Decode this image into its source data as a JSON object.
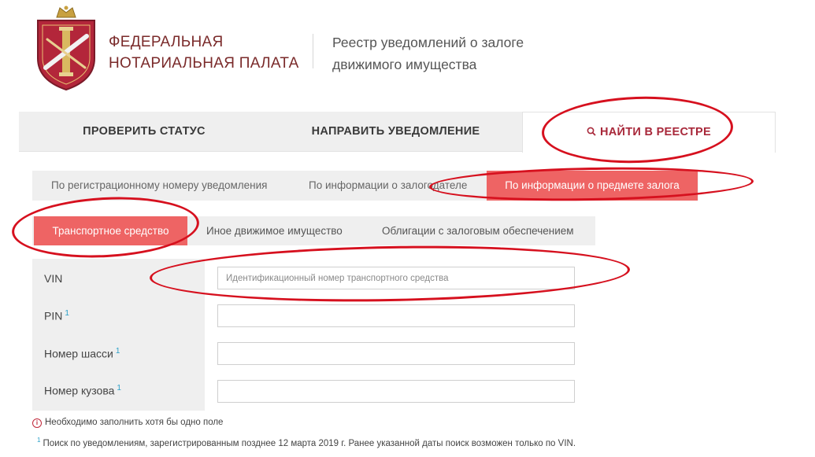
{
  "header": {
    "org_line1": "ФЕДЕРАЛЬНАЯ",
    "org_line2": "НОТАРИАЛЬНАЯ ПАЛАТА",
    "registry_line1": "Реестр уведомлений о залоге",
    "registry_line2": "движимого имущества"
  },
  "main_tabs": [
    {
      "label": "ПРОВЕРИТЬ СТАТУС"
    },
    {
      "label": "НАПРАВИТЬ УВЕДОМЛЕНИЕ"
    },
    {
      "label": "НАЙТИ В РЕЕСТРЕ",
      "icon": "search-icon",
      "active": true
    }
  ],
  "sub_tabs": [
    {
      "label": "По регистрационному номеру уведомления"
    },
    {
      "label": "По информации о залогодателе"
    },
    {
      "label": "По информации о предмете залога",
      "active": true
    }
  ],
  "type_tabs": [
    {
      "label": "Транспортное средство",
      "active": true
    },
    {
      "label": "Иное движимое имущество"
    },
    {
      "label": "Облигации с залоговым обеспечением"
    }
  ],
  "form": {
    "fields": [
      {
        "label": "VIN",
        "footnote": "",
        "placeholder": "Идентификационный номер транспортного средства",
        "value": ""
      },
      {
        "label": "PIN",
        "footnote": "1",
        "placeholder": "",
        "value": ""
      },
      {
        "label": "Номер шасси",
        "footnote": "1",
        "placeholder": "",
        "value": ""
      },
      {
        "label": "Номер кузова",
        "footnote": "1",
        "placeholder": "",
        "value": ""
      }
    ]
  },
  "notes": {
    "required": "Необходимо заполнить хотя бы одно поле",
    "footnote_mark": "1",
    "footnote": "Поиск по уведомлениям, зарегистрированным позднее 12 марта 2019 г. Ранее указанной даты поиск возможен только по VIN."
  },
  "colors": {
    "accent": "#ee6464",
    "brand": "#7a2a2a",
    "annotation": "#d6101e",
    "info": "#2aa0c8"
  }
}
